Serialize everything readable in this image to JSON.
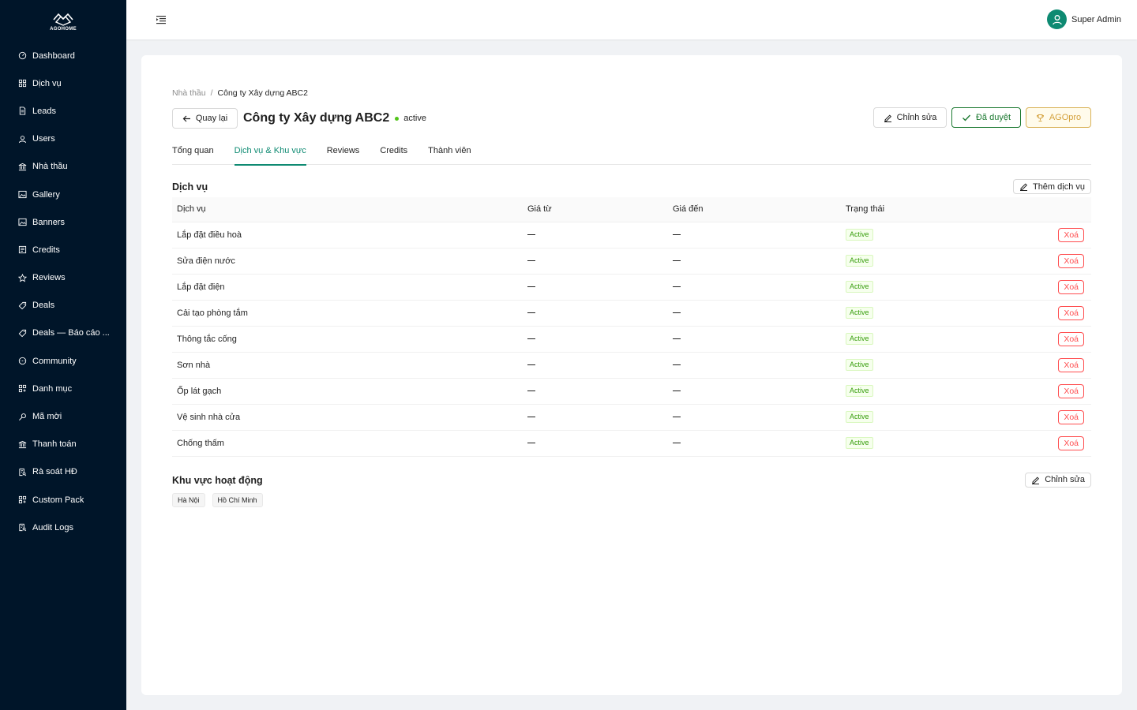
{
  "app": {
    "logo_text": "AGOHOME"
  },
  "sidebar": {
    "items": [
      {
        "label": "Dashboard",
        "icon": "dashboard-icon"
      },
      {
        "label": "Dịch vụ",
        "icon": "grid-icon"
      },
      {
        "label": "Leads",
        "icon": "file-icon"
      },
      {
        "label": "Users",
        "icon": "user-icon"
      },
      {
        "label": "Nhà thầu",
        "icon": "bank-icon"
      },
      {
        "label": "Gallery",
        "icon": "picture-icon"
      },
      {
        "label": "Banners",
        "icon": "picture-icon"
      },
      {
        "label": "Credits",
        "icon": "wallet-icon"
      },
      {
        "label": "Reviews",
        "icon": "star-icon"
      },
      {
        "label": "Deals",
        "icon": "tag-icon"
      },
      {
        "label": "Deals — Báo cáo ...",
        "icon": "tag-icon"
      },
      {
        "label": "Community",
        "icon": "message-icon"
      },
      {
        "label": "Danh mục",
        "icon": "appstore-icon"
      },
      {
        "label": "Mã mời",
        "icon": "key-icon"
      },
      {
        "label": "Thanh toán",
        "icon": "bank-icon"
      },
      {
        "label": "Rà soát HĐ",
        "icon": "audit-icon"
      },
      {
        "label": "Custom Pack",
        "icon": "appstore-icon"
      },
      {
        "label": "Audit Logs",
        "icon": "audit-icon"
      }
    ]
  },
  "header": {
    "user_name": "Super Admin"
  },
  "breadcrumb": {
    "parent": "Nhà thầu",
    "separator": "/",
    "current": "Công ty Xây dựng ABC2"
  },
  "page": {
    "back_label": "Quay lại",
    "title": "Công ty Xây dựng ABC2",
    "status": "active",
    "edit_label": "Chỉnh sửa",
    "approved_label": "Đã duyệt",
    "agopro_label": "AGOpro"
  },
  "tabs": [
    {
      "label": "Tổng quan",
      "active": false
    },
    {
      "label": "Dịch vụ & Khu vực",
      "active": true
    },
    {
      "label": "Reviews",
      "active": false
    },
    {
      "label": "Credits",
      "active": false
    },
    {
      "label": "Thành viên",
      "active": false
    }
  ],
  "services": {
    "title": "Dịch vụ",
    "add_label": "Thêm dịch vụ",
    "columns": [
      "Dịch vụ",
      "Giá từ",
      "Giá đến",
      "Trạng thái"
    ],
    "rows": [
      {
        "name": "Lắp đặt điều hoà",
        "price_from": "—",
        "price_to": "—",
        "status": "Active",
        "action": "Xoá"
      },
      {
        "name": "Sửa điện nước",
        "price_from": "—",
        "price_to": "—",
        "status": "Active",
        "action": "Xoá"
      },
      {
        "name": "Lắp đặt điện",
        "price_from": "—",
        "price_to": "—",
        "status": "Active",
        "action": "Xoá"
      },
      {
        "name": "Cải tạo phòng tắm",
        "price_from": "—",
        "price_to": "—",
        "status": "Active",
        "action": "Xoá"
      },
      {
        "name": "Thông tắc cống",
        "price_from": "—",
        "price_to": "—",
        "status": "Active",
        "action": "Xoá"
      },
      {
        "name": "Sơn nhà",
        "price_from": "—",
        "price_to": "—",
        "status": "Active",
        "action": "Xoá"
      },
      {
        "name": "Ốp lát gạch",
        "price_from": "—",
        "price_to": "—",
        "status": "Active",
        "action": "Xoá"
      },
      {
        "name": "Vệ sinh nhà cửa",
        "price_from": "—",
        "price_to": "—",
        "status": "Active",
        "action": "Xoá"
      },
      {
        "name": "Chống thấm",
        "price_from": "—",
        "price_to": "—",
        "status": "Active",
        "action": "Xoá"
      }
    ]
  },
  "regions": {
    "title": "Khu vực hoạt động",
    "edit_label": "Chỉnh sửa",
    "items": [
      "Hà Nội",
      "Hồ Chí Minh"
    ]
  },
  "colors": {
    "sidebar_bg": "#001529",
    "accent": "#0e8a72",
    "danger": "#ff4d4f",
    "success": "#52c41a"
  }
}
